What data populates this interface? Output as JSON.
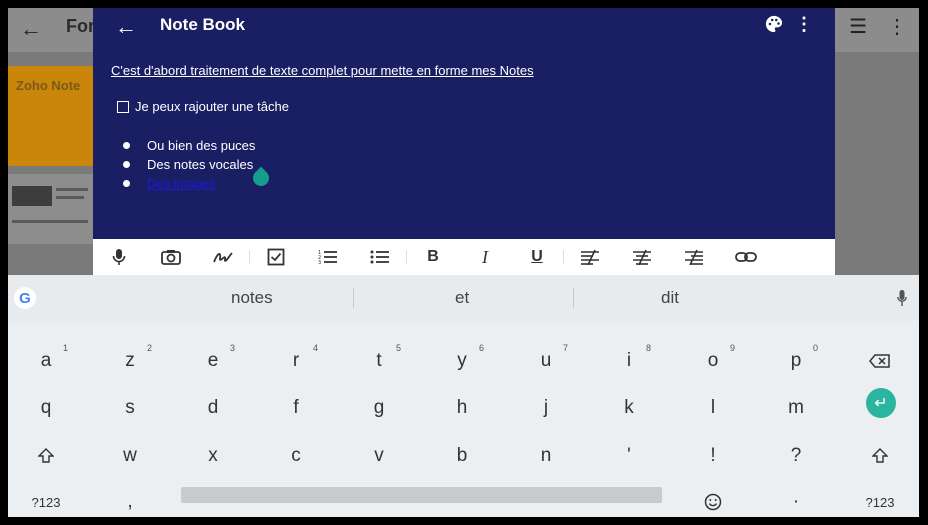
{
  "background_app": {
    "title": "For",
    "card_title": "Zoho Note"
  },
  "panel": {
    "title": "Note Book",
    "line1": "C'est d'abord traitement de texte complet pour mette en forme mes Notes ",
    "task": "Je peux rajouter une tâche",
    "bullets": [
      "Ou bien des puces",
      "Des notes vocales"
    ],
    "link_bullet": "Des images"
  },
  "toolbar": {
    "icons": [
      "mic-icon",
      "camera-icon",
      "pen-icon",
      "checklist-icon",
      "numbered-list-icon",
      "bullet-list-icon",
      "bold-icon",
      "italic-icon",
      "underline-icon",
      "strikethrough-icon",
      "strikethrough-alt-icon",
      "strikethrough-alt2-icon",
      "link-icon"
    ],
    "bold": "B",
    "italic": "I",
    "underline": "U"
  },
  "keyboard": {
    "suggestions": [
      "notes",
      "et",
      "dit"
    ],
    "row1": [
      {
        "k": "a",
        "h": "1"
      },
      {
        "k": "z",
        "h": "2"
      },
      {
        "k": "e",
        "h": "3"
      },
      {
        "k": "r",
        "h": "4"
      },
      {
        "k": "t",
        "h": "5"
      },
      {
        "k": "y",
        "h": "6"
      },
      {
        "k": "u",
        "h": "7"
      },
      {
        "k": "i",
        "h": "8"
      },
      {
        "k": "o",
        "h": "9"
      },
      {
        "k": "p",
        "h": "0"
      }
    ],
    "row2": [
      "q",
      "s",
      "d",
      "f",
      "g",
      "h",
      "j",
      "k",
      "l",
      "m"
    ],
    "row3": [
      "w",
      "x",
      "c",
      "v",
      "b",
      "n",
      "'",
      "!",
      "?"
    ],
    "bottom": {
      "sym_left": "?123",
      "comma": ",",
      "period": "·",
      "sym_right": "?123"
    }
  }
}
